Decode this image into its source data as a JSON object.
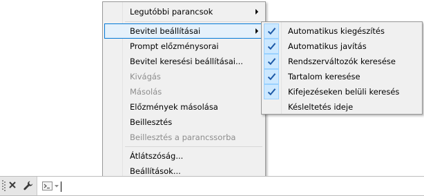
{
  "menu": {
    "items": [
      {
        "label": "Legutóbbi parancsok",
        "state": "normal",
        "submenu": true
      },
      {
        "label": "Bevitel beállításai",
        "state": "highlighted",
        "submenu": true
      },
      {
        "label": "Prompt előzménysorai",
        "state": "normal"
      },
      {
        "label": "Bevitel keresési beállításai...",
        "state": "normal"
      },
      {
        "label": "Kivágás",
        "state": "disabled"
      },
      {
        "label": "Másolás",
        "state": "disabled"
      },
      {
        "label": "Előzmények másolása",
        "state": "normal"
      },
      {
        "label": "Beillesztés",
        "state": "normal"
      },
      {
        "label": "Beillesztés a parancssorba",
        "state": "disabled"
      },
      {
        "label": "Átlátszóság...",
        "state": "normal"
      },
      {
        "label": "Beállítások...",
        "state": "normal"
      }
    ]
  },
  "submenu": {
    "items": [
      {
        "label": "Automatikus kiegészítés",
        "checked": true
      },
      {
        "label": "Automatikus javítás",
        "checked": true
      },
      {
        "label": "Rendszerváltozók keresése",
        "checked": true
      },
      {
        "label": "Tartalom keresése",
        "checked": true
      },
      {
        "label": "Kifejezéseken belüli keresés",
        "checked": true
      },
      {
        "label": "Késleltetés ideje",
        "checked": false
      }
    ]
  },
  "command_line": {
    "value": "",
    "icons": [
      "grip-icon",
      "close-icon",
      "wrench-icon",
      "prompt-icon",
      "chevron-down-icon"
    ]
  },
  "colors": {
    "menu_bg": "#f0f0f0",
    "highlight_bg": "#e5f1fb",
    "highlight_border": "#0078d7",
    "check_bg": "#cce8ff",
    "check_mark": "#1e5aa8",
    "disabled_text": "#8d8d8d"
  }
}
